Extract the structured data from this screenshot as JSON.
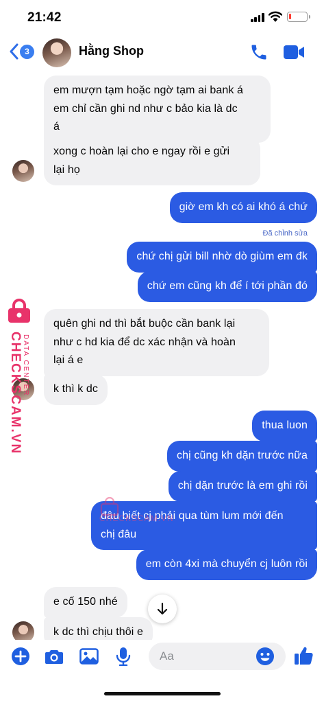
{
  "status_bar": {
    "time": "21:42",
    "battery_level": 0.1
  },
  "header": {
    "back_badge_count": "3",
    "contact_name": "Hằng Shop"
  },
  "messages": [
    {
      "side": "in",
      "lines": [
        "em mượn tạm hoặc ngờ tạm ai bank á",
        "em chỉ cần ghi nd như c bảo kia là dc",
        "á"
      ]
    },
    {
      "side": "in",
      "lines": [
        "xong c hoàn lại cho e ngay rồi e gửi",
        "lại họ"
      ]
    },
    {
      "side": "out",
      "lines": [
        "giờ em kh có ai khó á chứ"
      ]
    },
    {
      "side": "out",
      "lines": [
        "chứ chị gửi bill nhờ dò giùm em đk"
      ]
    },
    {
      "side": "out",
      "lines": [
        "chứ em cũng kh để í tới phần đó"
      ]
    },
    {
      "side": "in",
      "lines": [
        "quên ghi nd thì bắt buộc cần bank lại",
        "như c hd kia để dc xác nhận và hoàn",
        "lại á e"
      ]
    },
    {
      "side": "in",
      "lines": [
        "k thì k dc"
      ]
    },
    {
      "side": "out",
      "lines": [
        "thua luon"
      ]
    },
    {
      "side": "out",
      "lines": [
        "chị cũng kh dặn trước nữa"
      ]
    },
    {
      "side": "out",
      "lines": [
        "chị dặn trước là em ghi rồi"
      ]
    },
    {
      "side": "out",
      "lines": [
        "đâu biết cj phải qua tùm lum mới đến",
        "chị đâu"
      ]
    },
    {
      "side": "out",
      "lines": [
        "em còn 4xi mà chuyển cj luôn rồi"
      ]
    },
    {
      "side": "in",
      "lines": [
        "e cố 150 nhé"
      ]
    },
    {
      "side": "in",
      "lines": [
        "k dc thì chịu thôi e"
      ]
    }
  ],
  "edited_label": "Đã chỉnh sửa",
  "watermark": {
    "big": "CHECKSCAM.VN",
    "small": "DATA CENTER",
    "center": "CHECKSCAM.VN"
  },
  "composer": {
    "placeholder": "Aa"
  },
  "colors": {
    "accent": "#2b5be3",
    "incoming_bg": "#f0f0f2",
    "icon_blue": "#1f5fe0",
    "watermark": "#e8336a"
  },
  "icons": [
    "back-icon",
    "phone-icon",
    "video-icon",
    "plus-icon",
    "camera-icon",
    "image-icon",
    "microphone-icon",
    "emoji-icon",
    "thumbs-up-icon",
    "chevron-down-icon"
  ]
}
